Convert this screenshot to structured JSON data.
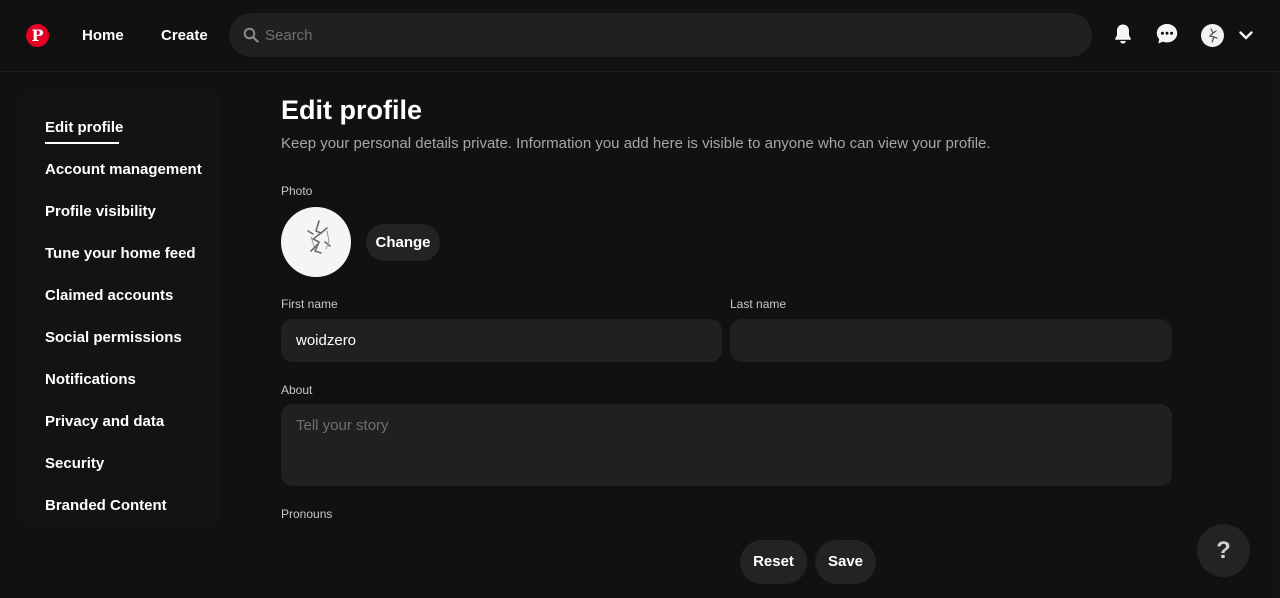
{
  "nav": {
    "logo": "P",
    "home": "Home",
    "create": "Create",
    "search_placeholder": "Search",
    "icons": [
      "pinterest-logo",
      "search-icon",
      "bell-icon",
      "chat-icon",
      "avatar",
      "chevron-down-icon"
    ]
  },
  "sidebar": {
    "items": [
      {
        "label": "Edit profile",
        "active": true
      },
      {
        "label": "Account management"
      },
      {
        "label": "Profile visibility"
      },
      {
        "label": "Tune your home feed"
      },
      {
        "label": "Claimed accounts"
      },
      {
        "label": "Social permissions"
      },
      {
        "label": "Notifications"
      },
      {
        "label": "Privacy and data"
      },
      {
        "label": "Security"
      },
      {
        "label": "Branded Content"
      }
    ]
  },
  "main": {
    "title": "Edit profile",
    "description": "Keep your personal details private. Information you add here is visible to anyone who can view your profile.",
    "photo_label": "Photo",
    "change_label": "Change",
    "first_name_label": "First name",
    "first_name_value": "woidzero",
    "last_name_label": "Last name",
    "last_name_value": "",
    "about_label": "About",
    "about_placeholder": "Tell your story",
    "pronouns_label": "Pronouns"
  },
  "actions": {
    "reset": "Reset",
    "save": "Save",
    "help": "?"
  },
  "colors": {
    "background": "#111111",
    "surface": "#202020",
    "brand": "#e60023",
    "text": "#ffffff",
    "muted": "#a6a6a6"
  }
}
